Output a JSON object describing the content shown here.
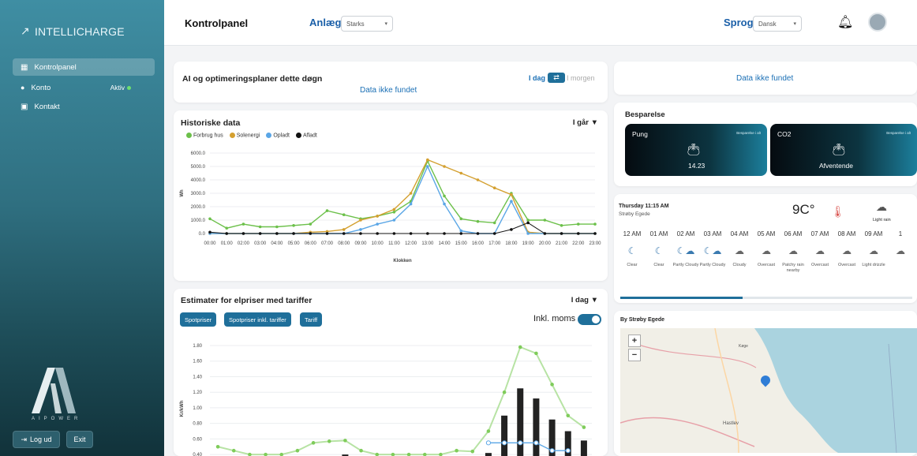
{
  "sidebar": {
    "brand": "INTELLICHARGE",
    "items": [
      {
        "label": "Kontrolpanel"
      },
      {
        "label": "Konto",
        "status": "Aktiv"
      },
      {
        "label": "Kontakt"
      }
    ],
    "logo_text": "AIPOWER",
    "logout_label": "Log ud",
    "exit_label": "Exit"
  },
  "header": {
    "title": "Kontrolpanel",
    "anlaeg_label": "Anlæg",
    "anlaeg_value": "Starks",
    "sprog_label": "Sprog",
    "sprog_value": "Dansk"
  },
  "ai_card": {
    "title": "AI og optimeringsplaner dette døgn",
    "no_data": "Data ikke fundet",
    "today": "I dag",
    "tomorrow": "I morgen"
  },
  "right_top": {
    "no_data": "Data ikke fundet"
  },
  "history": {
    "title": "Historiske data",
    "period": "I går ▼"
  },
  "savings": {
    "title": "Besparelse",
    "tiles": [
      {
        "name": "Pung",
        "sub": "Besparelse i alt",
        "value": "14.23"
      },
      {
        "name": "CO2",
        "sub": "Besparelse i alt",
        "value": "Afventende"
      }
    ]
  },
  "weather": {
    "datetime": "Thursday 11:15 AM",
    "location": "Strøby Egede",
    "temp": "9C°",
    "now_condition": "Light rain",
    "hours": [
      {
        "time": "12 AM",
        "icon": "moon-icon",
        "cond": "Clear"
      },
      {
        "time": "01 AM",
        "icon": "moon-icon",
        "cond": "Clear"
      },
      {
        "time": "02 AM",
        "icon": "moon-cloud-icon",
        "cond": "Partly Cloudy"
      },
      {
        "time": "03 AM",
        "icon": "moon-cloud-icon",
        "cond": "Partly Cloudy"
      },
      {
        "time": "04 AM",
        "icon": "cloud-icon",
        "cond": "Cloudy"
      },
      {
        "time": "05 AM",
        "icon": "cloud-icon",
        "cond": "Overcast"
      },
      {
        "time": "06 AM",
        "icon": "rain-cloud-icon",
        "cond": "Patchy rain nearby"
      },
      {
        "time": "07 AM",
        "icon": "cloud-icon",
        "cond": "Overcast"
      },
      {
        "time": "08 AM",
        "icon": "cloud-icon",
        "cond": "Overcast"
      },
      {
        "time": "09 AM",
        "icon": "rain-cloud-icon",
        "cond": "Light drizzle"
      },
      {
        "time": "1",
        "icon": "cloud-icon",
        "cond": ""
      }
    ]
  },
  "map": {
    "title": "By Strøby Egede",
    "zoom_in": "+",
    "zoom_out": "−",
    "labels": {
      "town1": "Køge",
      "town2": "Hastlev"
    }
  },
  "prices": {
    "title": "Estimater for elpriser med tariffer",
    "period": "I dag ▼",
    "buttons": [
      "Spotpriser",
      "Spotpriser inkl. tariffer",
      "Tariff"
    ],
    "toggle_label": "Inkl. moms"
  },
  "colors": {
    "consumption": "#6cc04a",
    "solar": "#d4a030",
    "charged": "#5aa6e6",
    "discharged": "#111111",
    "accent": "#1f6f9a"
  },
  "chart_data": [
    {
      "type": "line",
      "xlabel": "Klokken",
      "ylabel": "Wh",
      "ylim": [
        0,
        6000
      ],
      "yticks": [
        "0.0",
        "1000.0",
        "2000.0",
        "3000.0",
        "4000.0",
        "5000.0",
        "6000.0"
      ],
      "grid": true,
      "legend": "top-left",
      "categories": [
        "00:00",
        "01:00",
        "02:00",
        "03:00",
        "04:00",
        "05:00",
        "06:00",
        "07:00",
        "08:00",
        "09:00",
        "10:00",
        "11:00",
        "12:00",
        "13:00",
        "14:00",
        "15:00",
        "16:00",
        "17:00",
        "18:00",
        "19:00",
        "20:00",
        "21:00",
        "22:00",
        "23:00"
      ],
      "series": [
        {
          "name": "Forbrug hus",
          "values": [
            1100,
            400,
            700,
            500,
            500,
            600,
            700,
            1700,
            1400,
            1100,
            1300,
            1600,
            2400,
            5400,
            2800,
            1100,
            900,
            800,
            3000,
            1000,
            1000,
            600,
            700,
            700
          ]
        },
        {
          "name": "Solenergi",
          "values": [
            0,
            0,
            0,
            0,
            0,
            0,
            100,
            150,
            300,
            1000,
            1300,
            1800,
            3000,
            5500,
            5000,
            4500,
            4000,
            3400,
            2900,
            100,
            0,
            0,
            0,
            0
          ]
        },
        {
          "name": "Opladt",
          "values": [
            0,
            0,
            0,
            0,
            0,
            0,
            0,
            0,
            0,
            300,
            700,
            1000,
            2200,
            5000,
            2200,
            200,
            0,
            0,
            2400,
            0,
            0,
            0,
            0,
            0
          ]
        },
        {
          "name": "Afladt",
          "values": [
            100,
            0,
            0,
            0,
            0,
            0,
            0,
            0,
            0,
            0,
            0,
            0,
            0,
            0,
            0,
            0,
            0,
            0,
            300,
            800,
            0,
            0,
            0,
            0
          ]
        }
      ]
    },
    {
      "type": "bar",
      "ylabel": "Kr/kWh",
      "ylim": [
        0.3,
        1.8
      ],
      "yticks": [
        "0.40",
        "0.60",
        "0.80",
        "1.00",
        "1.20",
        "1.40",
        "1.60",
        "1.80"
      ],
      "grid": true,
      "series": [
        {
          "name": "Spotpriser",
          "values": [
            0.38,
            0.35,
            0.33,
            0.3,
            0.3,
            0.3,
            0.3,
            0.38,
            0.4,
            0.36,
            0.3,
            0.3,
            0.3,
            0.3,
            0.3,
            0.3,
            0.3,
            0.42,
            0.9,
            1.25,
            1.12,
            0.85,
            0.7,
            0.58
          ]
        },
        {
          "name": "Spotpriser inkl. tariffer",
          "values": [
            0.5,
            0.45,
            0.4,
            0.4,
            0.4,
            0.45,
            0.55,
            0.57,
            0.58,
            0.45,
            0.4,
            0.4,
            0.4,
            0.4,
            0.4,
            0.45,
            0.44,
            0.7,
            1.2,
            1.78,
            1.7,
            1.3,
            0.9,
            0.75
          ]
        },
        {
          "name": "Tariff",
          "values": [
            null,
            null,
            null,
            null,
            null,
            null,
            null,
            null,
            null,
            null,
            null,
            null,
            null,
            null,
            null,
            null,
            null,
            0.55,
            0.55,
            0.55,
            0.55,
            0.45,
            0.45,
            null
          ]
        }
      ]
    }
  ]
}
